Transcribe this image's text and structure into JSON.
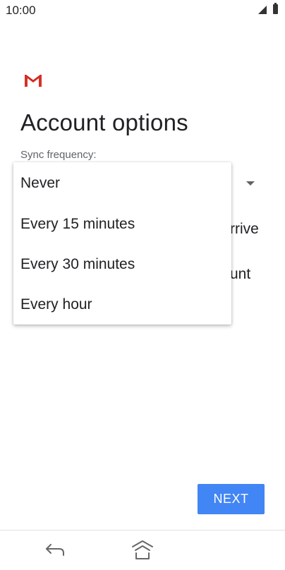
{
  "status_bar": {
    "time": "10:00",
    "signal_icon": "signal-icon",
    "battery_icon": "battery-icon"
  },
  "app": {
    "logo_icon": "gmail-icon",
    "logo_colors": [
      "#d93025",
      "#c5221f"
    ]
  },
  "page": {
    "title": "Account options",
    "sync_label": "Sync frequency:"
  },
  "background_options": {
    "partial_text_1": "rrive",
    "partial_text_2": "unt"
  },
  "dropdown": {
    "options": [
      {
        "label": "Never"
      },
      {
        "label": "Every 15 minutes"
      },
      {
        "label": "Every 30 minutes"
      },
      {
        "label": "Every hour"
      }
    ]
  },
  "actions": {
    "next_label": "NEXT",
    "next_color": "#4285f4"
  },
  "nav": {
    "back_icon": "back-icon",
    "home_icon": "home-icon"
  }
}
